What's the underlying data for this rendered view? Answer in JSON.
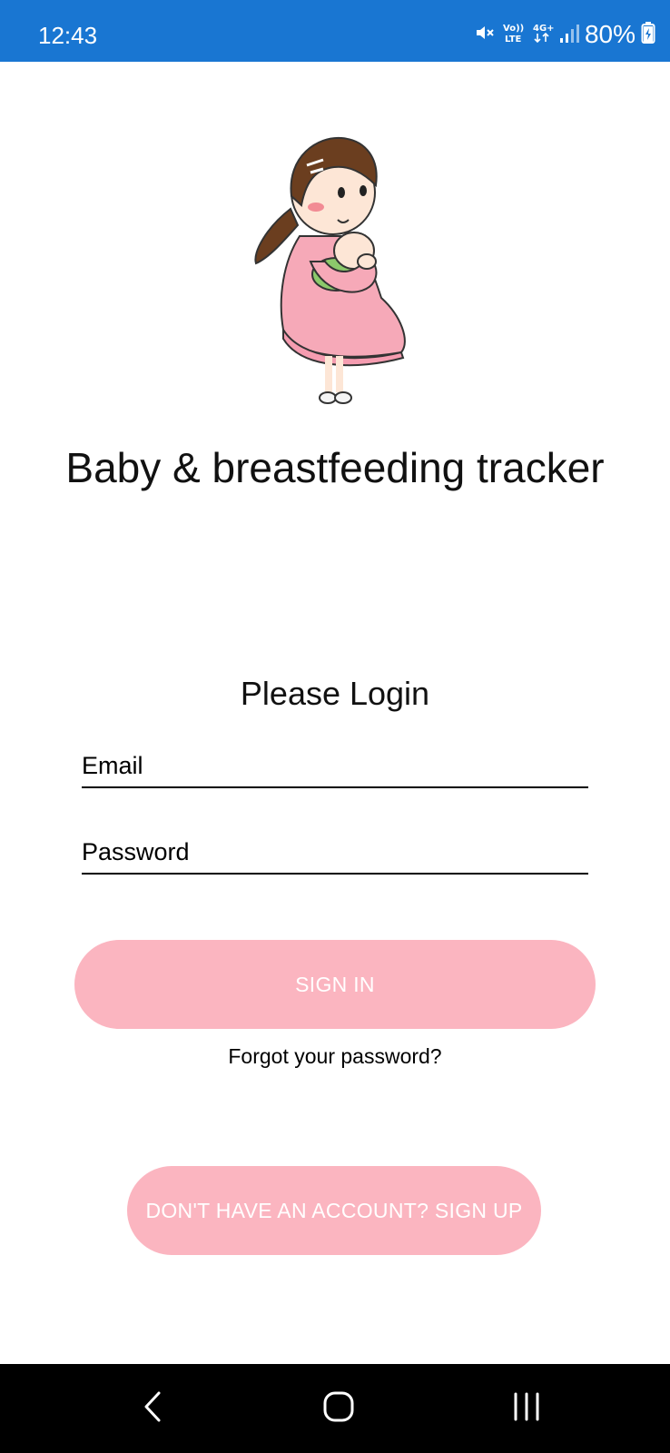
{
  "status_bar": {
    "time": "12:43",
    "battery": "80%",
    "icons": [
      "mute-icon",
      "volte-icon",
      "4g-plus-icon",
      "signal-icon",
      "battery-charging-icon"
    ],
    "volte_text": "Vo)) LTE",
    "network_text": "4G+"
  },
  "app": {
    "title": "Baby & breastfeeding tracker",
    "illustration": "mother-breastfeeding-illustration"
  },
  "login": {
    "heading": "Please Login",
    "email_placeholder": "Email",
    "password_placeholder": "Password",
    "signin_label": "SIGN IN",
    "forgot_label": "Forgot your password?",
    "signup_label": "DON'T HAVE AN ACCOUNT? SIGN UP"
  },
  "nav_bar": {
    "buttons": [
      "back-icon",
      "home-icon",
      "recents-icon"
    ]
  },
  "colors": {
    "status_bar": "#1976d2",
    "button_pink": "#fbb5c0",
    "background": "#ffffff",
    "nav_bar": "#000000"
  }
}
